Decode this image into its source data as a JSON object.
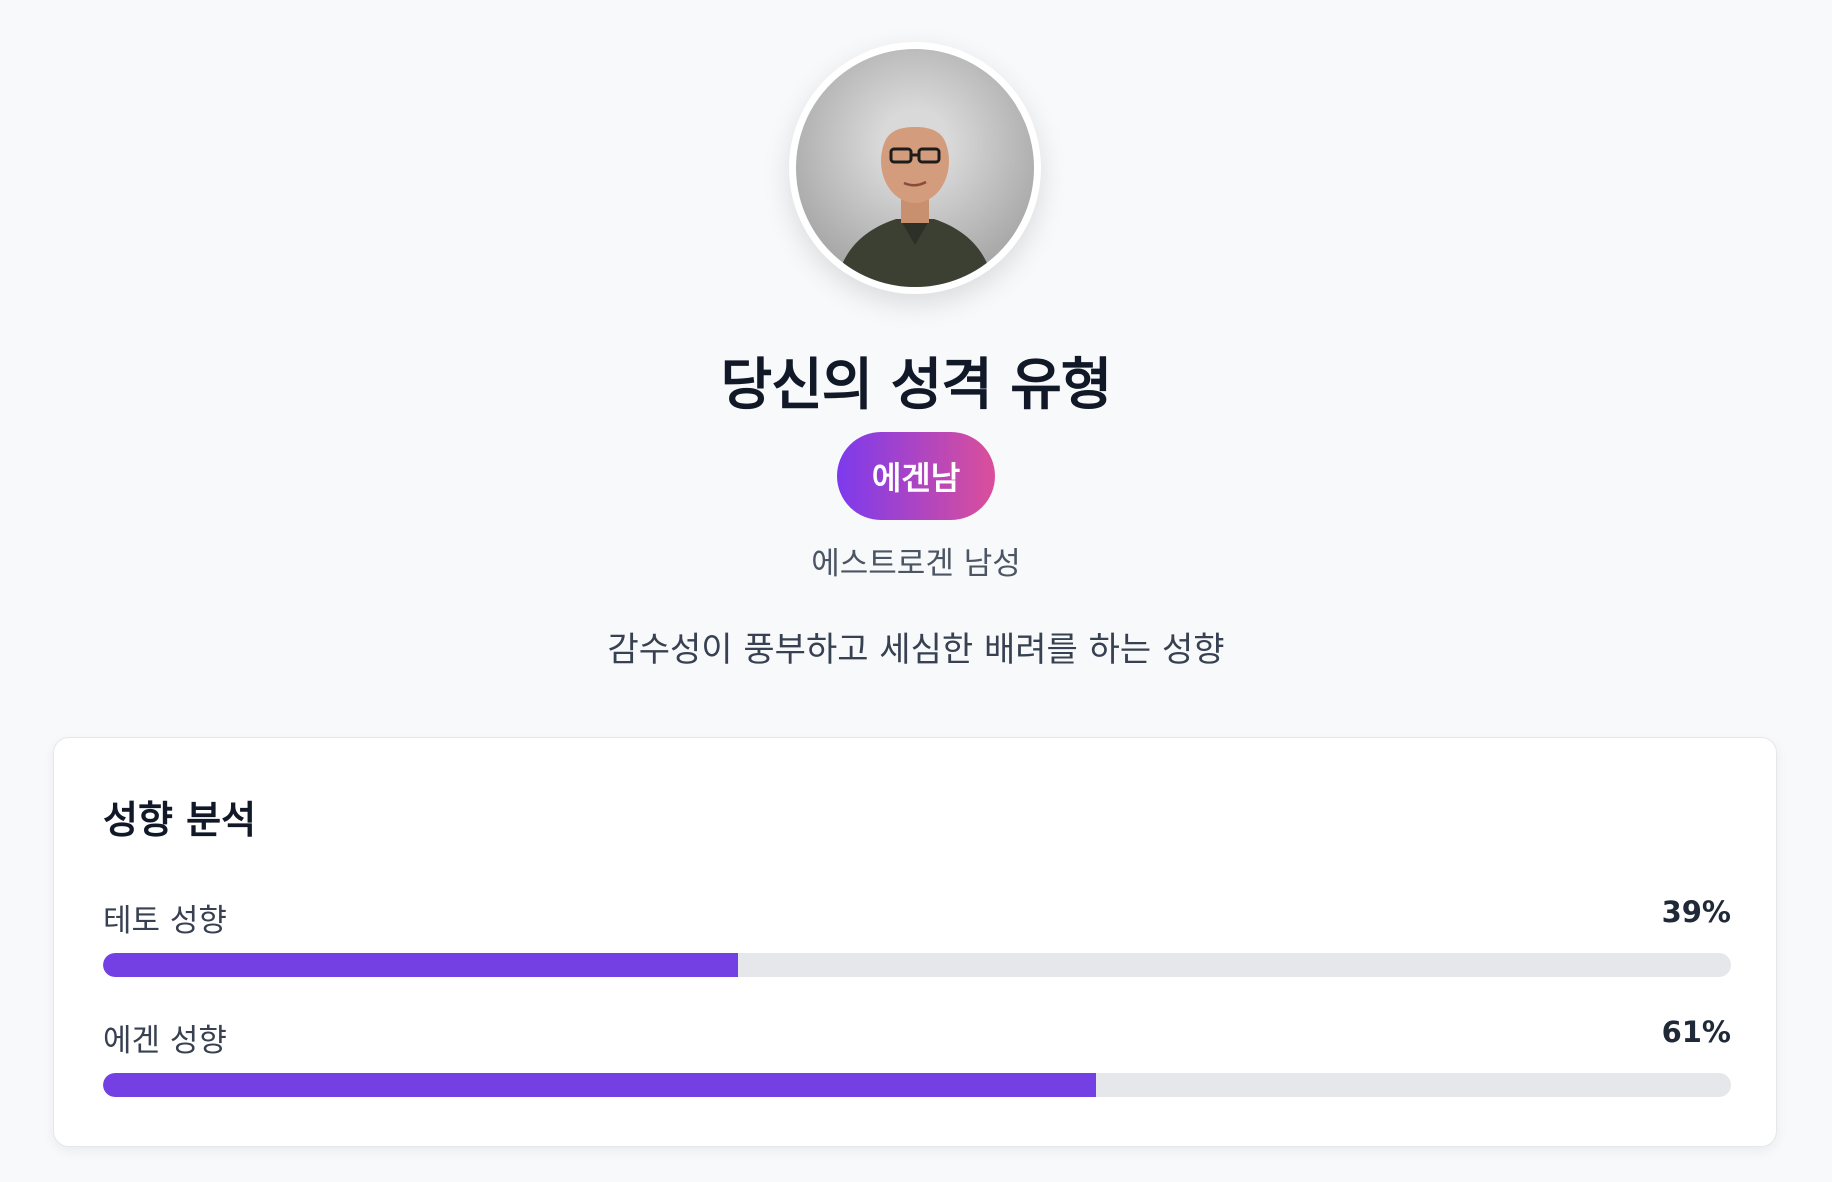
{
  "header": {
    "title": "당신의 성격 유형",
    "badge": "에겐남",
    "subtitle": "에스트로겐 남성",
    "description": "감수성이 풍부하고 세심한 배려를 하는 성향"
  },
  "analysis": {
    "title": "성향 분석",
    "metrics": [
      {
        "label": "테토 성향",
        "value_text": "39%",
        "percent": 39
      },
      {
        "label": "에겐 성향",
        "value_text": "61%",
        "percent": 61
      }
    ]
  },
  "colors": {
    "accent": "#7440e4",
    "badge_gradient_start": "#7c3aed",
    "badge_gradient_end": "#db4f9a",
    "track": "#e5e7eb",
    "background": "#f8f9fb"
  }
}
